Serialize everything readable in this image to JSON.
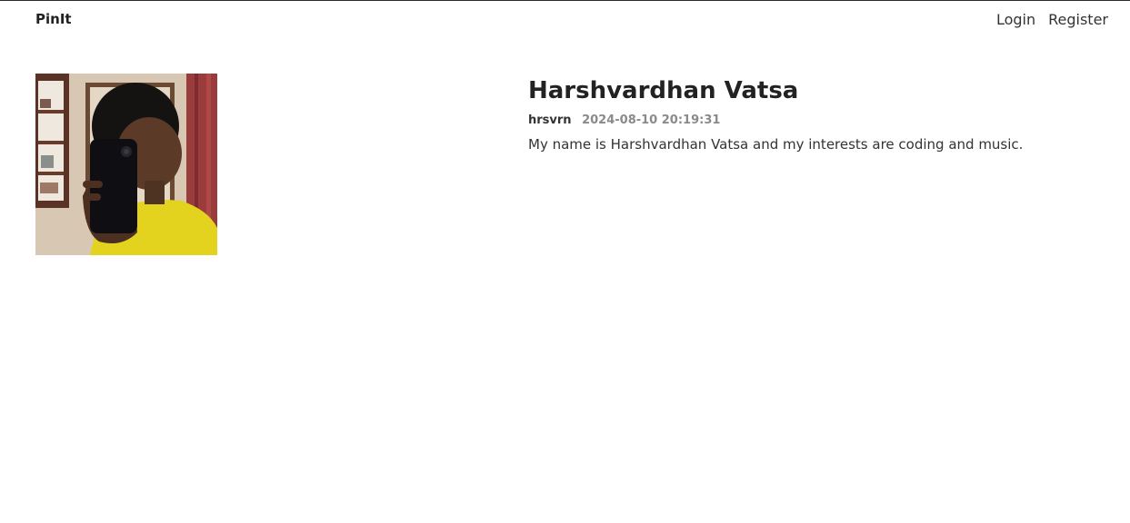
{
  "nav": {
    "brand": "PinIt",
    "links": [
      "Login",
      "Register"
    ]
  },
  "profile": {
    "name": "Harshvardhan Vatsa",
    "username": "hrsvrn",
    "timestamp": "2024-08-10 20:19:31",
    "bio": "My name is Harshvardhan Vatsa and my interests are coding and music."
  },
  "colors": {
    "text": "#222222",
    "muted": "#8a8a8a",
    "shirt": "#e3d21e",
    "curtain": "#9a3b3c"
  }
}
